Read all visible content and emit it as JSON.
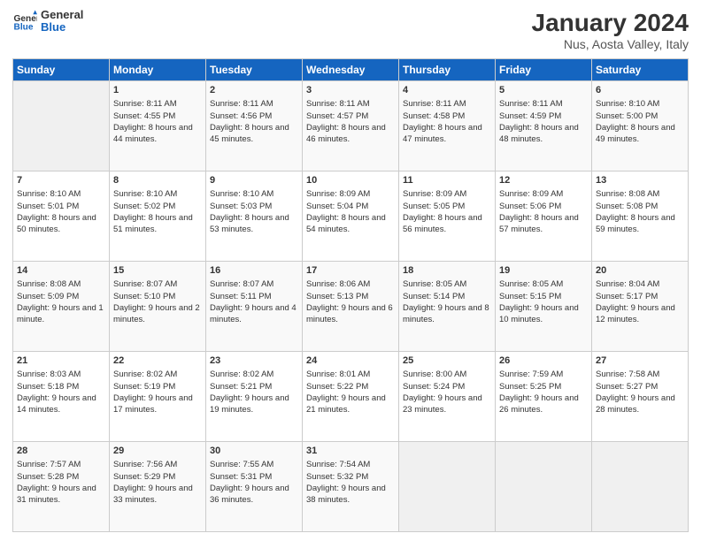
{
  "header": {
    "logo_line1": "General",
    "logo_line2": "Blue",
    "title": "January 2024",
    "subtitle": "Nus, Aosta Valley, Italy"
  },
  "days_of_week": [
    "Sunday",
    "Monday",
    "Tuesday",
    "Wednesday",
    "Thursday",
    "Friday",
    "Saturday"
  ],
  "weeks": [
    [
      {
        "day": "",
        "sunrise": "",
        "sunset": "",
        "daylight": ""
      },
      {
        "day": "1",
        "sunrise": "Sunrise: 8:11 AM",
        "sunset": "Sunset: 4:55 PM",
        "daylight": "Daylight: 8 hours and 44 minutes."
      },
      {
        "day": "2",
        "sunrise": "Sunrise: 8:11 AM",
        "sunset": "Sunset: 4:56 PM",
        "daylight": "Daylight: 8 hours and 45 minutes."
      },
      {
        "day": "3",
        "sunrise": "Sunrise: 8:11 AM",
        "sunset": "Sunset: 4:57 PM",
        "daylight": "Daylight: 8 hours and 46 minutes."
      },
      {
        "day": "4",
        "sunrise": "Sunrise: 8:11 AM",
        "sunset": "Sunset: 4:58 PM",
        "daylight": "Daylight: 8 hours and 47 minutes."
      },
      {
        "day": "5",
        "sunrise": "Sunrise: 8:11 AM",
        "sunset": "Sunset: 4:59 PM",
        "daylight": "Daylight: 8 hours and 48 minutes."
      },
      {
        "day": "6",
        "sunrise": "Sunrise: 8:10 AM",
        "sunset": "Sunset: 5:00 PM",
        "daylight": "Daylight: 8 hours and 49 minutes."
      }
    ],
    [
      {
        "day": "7",
        "sunrise": "Sunrise: 8:10 AM",
        "sunset": "Sunset: 5:01 PM",
        "daylight": "Daylight: 8 hours and 50 minutes."
      },
      {
        "day": "8",
        "sunrise": "Sunrise: 8:10 AM",
        "sunset": "Sunset: 5:02 PM",
        "daylight": "Daylight: 8 hours and 51 minutes."
      },
      {
        "day": "9",
        "sunrise": "Sunrise: 8:10 AM",
        "sunset": "Sunset: 5:03 PM",
        "daylight": "Daylight: 8 hours and 53 minutes."
      },
      {
        "day": "10",
        "sunrise": "Sunrise: 8:09 AM",
        "sunset": "Sunset: 5:04 PM",
        "daylight": "Daylight: 8 hours and 54 minutes."
      },
      {
        "day": "11",
        "sunrise": "Sunrise: 8:09 AM",
        "sunset": "Sunset: 5:05 PM",
        "daylight": "Daylight: 8 hours and 56 minutes."
      },
      {
        "day": "12",
        "sunrise": "Sunrise: 8:09 AM",
        "sunset": "Sunset: 5:06 PM",
        "daylight": "Daylight: 8 hours and 57 minutes."
      },
      {
        "day": "13",
        "sunrise": "Sunrise: 8:08 AM",
        "sunset": "Sunset: 5:08 PM",
        "daylight": "Daylight: 8 hours and 59 minutes."
      }
    ],
    [
      {
        "day": "14",
        "sunrise": "Sunrise: 8:08 AM",
        "sunset": "Sunset: 5:09 PM",
        "daylight": "Daylight: 9 hours and 1 minute."
      },
      {
        "day": "15",
        "sunrise": "Sunrise: 8:07 AM",
        "sunset": "Sunset: 5:10 PM",
        "daylight": "Daylight: 9 hours and 2 minutes."
      },
      {
        "day": "16",
        "sunrise": "Sunrise: 8:07 AM",
        "sunset": "Sunset: 5:11 PM",
        "daylight": "Daylight: 9 hours and 4 minutes."
      },
      {
        "day": "17",
        "sunrise": "Sunrise: 8:06 AM",
        "sunset": "Sunset: 5:13 PM",
        "daylight": "Daylight: 9 hours and 6 minutes."
      },
      {
        "day": "18",
        "sunrise": "Sunrise: 8:05 AM",
        "sunset": "Sunset: 5:14 PM",
        "daylight": "Daylight: 9 hours and 8 minutes."
      },
      {
        "day": "19",
        "sunrise": "Sunrise: 8:05 AM",
        "sunset": "Sunset: 5:15 PM",
        "daylight": "Daylight: 9 hours and 10 minutes."
      },
      {
        "day": "20",
        "sunrise": "Sunrise: 8:04 AM",
        "sunset": "Sunset: 5:17 PM",
        "daylight": "Daylight: 9 hours and 12 minutes."
      }
    ],
    [
      {
        "day": "21",
        "sunrise": "Sunrise: 8:03 AM",
        "sunset": "Sunset: 5:18 PM",
        "daylight": "Daylight: 9 hours and 14 minutes."
      },
      {
        "day": "22",
        "sunrise": "Sunrise: 8:02 AM",
        "sunset": "Sunset: 5:19 PM",
        "daylight": "Daylight: 9 hours and 17 minutes."
      },
      {
        "day": "23",
        "sunrise": "Sunrise: 8:02 AM",
        "sunset": "Sunset: 5:21 PM",
        "daylight": "Daylight: 9 hours and 19 minutes."
      },
      {
        "day": "24",
        "sunrise": "Sunrise: 8:01 AM",
        "sunset": "Sunset: 5:22 PM",
        "daylight": "Daylight: 9 hours and 21 minutes."
      },
      {
        "day": "25",
        "sunrise": "Sunrise: 8:00 AM",
        "sunset": "Sunset: 5:24 PM",
        "daylight": "Daylight: 9 hours and 23 minutes."
      },
      {
        "day": "26",
        "sunrise": "Sunrise: 7:59 AM",
        "sunset": "Sunset: 5:25 PM",
        "daylight": "Daylight: 9 hours and 26 minutes."
      },
      {
        "day": "27",
        "sunrise": "Sunrise: 7:58 AM",
        "sunset": "Sunset: 5:27 PM",
        "daylight": "Daylight: 9 hours and 28 minutes."
      }
    ],
    [
      {
        "day": "28",
        "sunrise": "Sunrise: 7:57 AM",
        "sunset": "Sunset: 5:28 PM",
        "daylight": "Daylight: 9 hours and 31 minutes."
      },
      {
        "day": "29",
        "sunrise": "Sunrise: 7:56 AM",
        "sunset": "Sunset: 5:29 PM",
        "daylight": "Daylight: 9 hours and 33 minutes."
      },
      {
        "day": "30",
        "sunrise": "Sunrise: 7:55 AM",
        "sunset": "Sunset: 5:31 PM",
        "daylight": "Daylight: 9 hours and 36 minutes."
      },
      {
        "day": "31",
        "sunrise": "Sunrise: 7:54 AM",
        "sunset": "Sunset: 5:32 PM",
        "daylight": "Daylight: 9 hours and 38 minutes."
      },
      {
        "day": "",
        "sunrise": "",
        "sunset": "",
        "daylight": ""
      },
      {
        "day": "",
        "sunrise": "",
        "sunset": "",
        "daylight": ""
      },
      {
        "day": "",
        "sunrise": "",
        "sunset": "",
        "daylight": ""
      }
    ]
  ]
}
